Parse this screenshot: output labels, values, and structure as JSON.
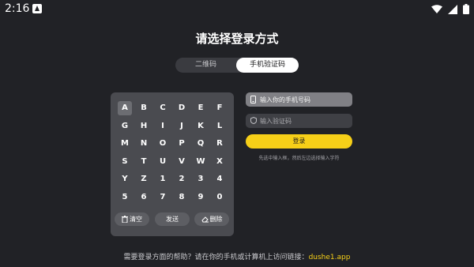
{
  "status_bar": {
    "time": "2:16",
    "notification_icon": "app-notification-icon",
    "icons": [
      "wifi-icon",
      "signal-icon",
      "battery-icon"
    ]
  },
  "title": "请选择登录方式",
  "tabs": [
    {
      "label": "二维码",
      "selected": false
    },
    {
      "label": "手机验证码",
      "selected": true
    }
  ],
  "keyboard": {
    "rows": [
      [
        "A",
        "B",
        "C",
        "D",
        "E",
        "F"
      ],
      [
        "G",
        "H",
        "I",
        "J",
        "K",
        "L"
      ],
      [
        "M",
        "N",
        "O",
        "P",
        "Q",
        "R"
      ],
      [
        "S",
        "T",
        "U",
        "V",
        "W",
        "X"
      ],
      [
        "Y",
        "Z",
        "1",
        "2",
        "3",
        "4"
      ],
      [
        "5",
        "6",
        "7",
        "8",
        "9",
        "0"
      ]
    ],
    "selected_key": "A",
    "actions": {
      "clear": {
        "label": "清空",
        "icon": "trash-icon"
      },
      "send": {
        "label": "发送"
      },
      "delete": {
        "label": "删除",
        "icon": "eraser-icon"
      }
    }
  },
  "form": {
    "phone": {
      "placeholder": "输入你的手机号码",
      "value": "",
      "icon": "phone-icon"
    },
    "code": {
      "placeholder": "输入验证码",
      "value": "",
      "icon": "shield-icon"
    },
    "login_label": "登录",
    "hint": "先选中输入框，然后左边选择输入字符"
  },
  "footer": {
    "text": "需要登录方面的帮助？请在你的手机或计算机上访问链接：",
    "link": "dushe1.app"
  },
  "colors": {
    "background": "#212226",
    "accent": "#f6cf18",
    "keyboard_bg": "#4a4b50"
  }
}
